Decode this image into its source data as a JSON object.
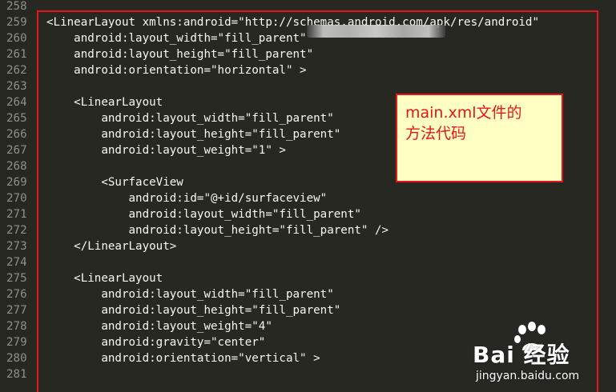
{
  "editor": {
    "lines": [
      {
        "n": "258",
        "text": ""
      },
      {
        "n": "259",
        "text": "<LinearLayout xmlns:android=\"http://schemas.android.com/apk/res/android\""
      },
      {
        "n": "260",
        "text": "    android:layout_width=\"fill_parent\""
      },
      {
        "n": "261",
        "text": "    android:layout_height=\"fill_parent\""
      },
      {
        "n": "262",
        "text": "    android:orientation=\"horizontal\" >"
      },
      {
        "n": "263",
        "text": ""
      },
      {
        "n": "264",
        "text": "    <LinearLayout"
      },
      {
        "n": "265",
        "text": "        android:layout_width=\"fill_parent\""
      },
      {
        "n": "266",
        "text": "        android:layout_height=\"fill_parent\""
      },
      {
        "n": "267",
        "text": "        android:layout_weight=\"1\" >"
      },
      {
        "n": "268",
        "text": ""
      },
      {
        "n": "269",
        "text": "        <SurfaceView"
      },
      {
        "n": "270",
        "text": "            android:id=\"@+id/surfaceview\""
      },
      {
        "n": "271",
        "text": "            android:layout_width=\"fill_parent\""
      },
      {
        "n": "272",
        "text": "            android:layout_height=\"fill_parent\" />"
      },
      {
        "n": "273",
        "text": "    </LinearLayout>"
      },
      {
        "n": "274",
        "text": ""
      },
      {
        "n": "275",
        "text": "    <LinearLayout"
      },
      {
        "n": "276",
        "text": "        android:layout_width=\"fill_parent\""
      },
      {
        "n": "277",
        "text": "        android:layout_height=\"fill_parent\""
      },
      {
        "n": "278",
        "text": "        android:layout_weight=\"4\""
      },
      {
        "n": "279",
        "text": "        android:gravity=\"center\""
      },
      {
        "n": "280",
        "text": "        android:orientation=\"vertical\" >"
      },
      {
        "n": "281",
        "text": ""
      }
    ]
  },
  "annotation": {
    "line1": "main.xml文件的",
    "line2": "方法代码"
  },
  "watermark": {
    "brand": "Bai  经验",
    "url": "jingyan.baidu.com"
  },
  "colors": {
    "background": "#272822",
    "text": "#f8f8f2",
    "line_number": "#8f908a",
    "highlight": "#e8141b",
    "note_background": "#ffffc4"
  }
}
